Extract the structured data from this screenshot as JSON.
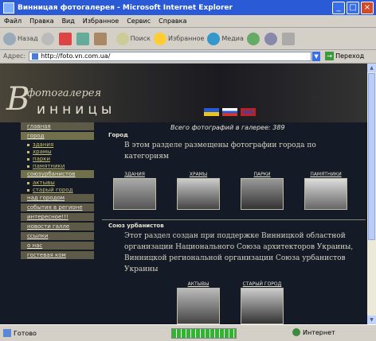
{
  "window": {
    "title": "Винницая фотогалерея - Microsoft Internet Explorer"
  },
  "menu": [
    "Файл",
    "Правка",
    "Вид",
    "Избранное",
    "Сервис",
    "Справка"
  ],
  "toolbar": {
    "back": "Назад",
    "search": "Поиск",
    "favorites": "Избранное",
    "media": "Медиа"
  },
  "address": {
    "label": "Адрес:",
    "value": "http://foto.vn.com.ua/",
    "go": "Переход"
  },
  "logo": {
    "top": "фотогалерея",
    "cap": "В",
    "main": "инницы"
  },
  "nav": {
    "items": [
      {
        "label": "главная"
      },
      {
        "label": "город",
        "subs": [
          "здания",
          "храмы",
          "парки",
          "памятники"
        ]
      },
      {
        "label": "союзурбанистов",
        "subs": [
          "актывы",
          "старый город"
        ]
      },
      {
        "label": "над городом"
      },
      {
        "label": "события в регионе"
      },
      {
        "label": "интересное!!!"
      },
      {
        "label": "новости галле"
      },
      {
        "label": "ссылки"
      },
      {
        "label": "о нас"
      },
      {
        "label": "гостевая ком"
      }
    ]
  },
  "main": {
    "total": "Всего фотографий в галерее: 389",
    "section1": {
      "title": "Город",
      "text": "В этом разделе размещены фотографии города по категориям"
    },
    "cats1": [
      "ЗДАНИЯ",
      "ХРАМЫ",
      "ПАРКИ",
      "ПАМЯТНИКИ"
    ],
    "section2": {
      "title": "Союз урбанистов",
      "text": "Этот раздел создан при поддержке Винницкой областной организации Национального Союза архитекторов Украины, Винницкой региональной организации Союза урбанистов Украины"
    },
    "cats2": [
      "АКТЫВЫ",
      "СТАРЫЙ ГОРОД"
    ]
  },
  "status": {
    "left": "Готово",
    "zone": "Интернет",
    "progress": 1.0
  },
  "colors": {
    "content_bg": "#141a26",
    "nav_bg": "#5e5a48",
    "accent": "#c8c070"
  }
}
